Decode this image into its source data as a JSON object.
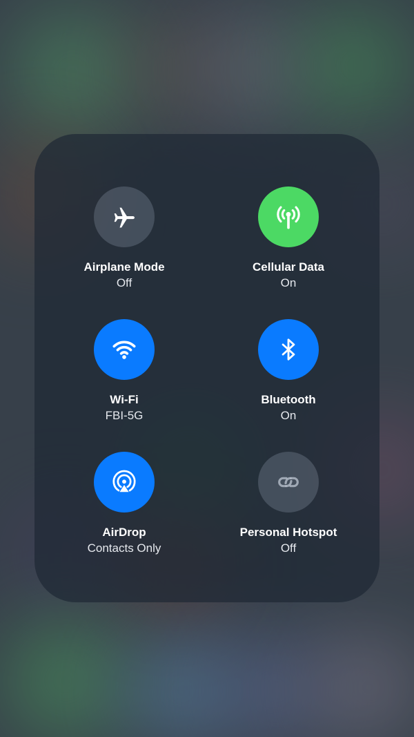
{
  "colors": {
    "accent_blue": "#0a7bff",
    "accent_green": "#4cd964",
    "inactive_gray": "rgba(120,132,148,0.38)",
    "panel_bg": "rgba(30,40,52,0.72)"
  },
  "tiles": [
    {
      "id": "airplane",
      "label": "Airplane Mode",
      "status": "Off",
      "icon": "airplane-icon",
      "state": "off"
    },
    {
      "id": "cellular",
      "label": "Cellular Data",
      "status": "On",
      "icon": "antenna-icon",
      "state": "on-green"
    },
    {
      "id": "wifi",
      "label": "Wi-Fi",
      "status": "FBI-5G",
      "icon": "wifi-icon",
      "state": "on-blue"
    },
    {
      "id": "bluetooth",
      "label": "Bluetooth",
      "status": "On",
      "icon": "bluetooth-icon",
      "state": "on-blue"
    },
    {
      "id": "airdrop",
      "label": "AirDrop",
      "status": "Contacts Only",
      "icon": "airdrop-icon",
      "state": "on-blue"
    },
    {
      "id": "hotspot",
      "label": "Personal Hotspot",
      "status": "Off",
      "icon": "link-icon",
      "state": "off"
    }
  ]
}
